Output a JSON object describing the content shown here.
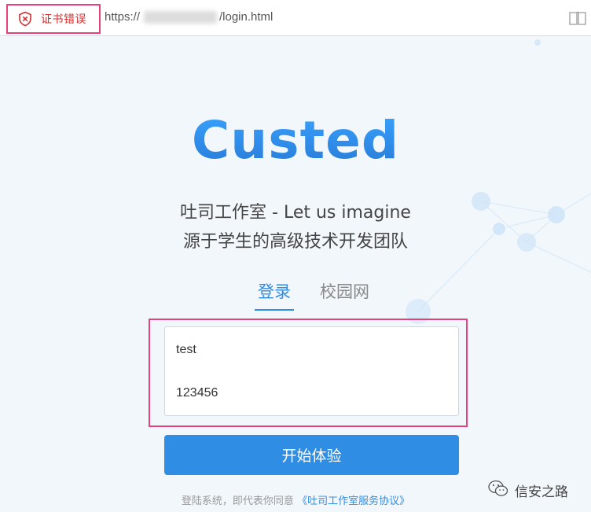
{
  "address_bar": {
    "cert_error_label": "证书错误",
    "url_prefix": "https://",
    "url_path": "/login.html",
    "icons": {
      "cert": "shield-x-icon",
      "reader": "reader-mode-icon"
    }
  },
  "brand": {
    "logo_text": "Custed",
    "tagline_line1": "吐司工作室 - Let us imagine",
    "tagline_line2": "源于学生的高级技术开发团队"
  },
  "tabs": [
    {
      "label": "登录",
      "active": true
    },
    {
      "label": "校园网",
      "active": false
    }
  ],
  "form": {
    "username_value": "test",
    "password_value": "123456",
    "submit_label": "开始体验"
  },
  "agreement": {
    "prefix": "登陆系统，即代表你同意",
    "link_text": "《吐司工作室服务协议》"
  },
  "watermark": {
    "text": "信安之路",
    "icon": "wechat-icon"
  },
  "colors": {
    "accent": "#2f8de4",
    "highlight_border": "#e8417a",
    "cert_error": "#d42e2e",
    "background": "#f2f7fc"
  }
}
